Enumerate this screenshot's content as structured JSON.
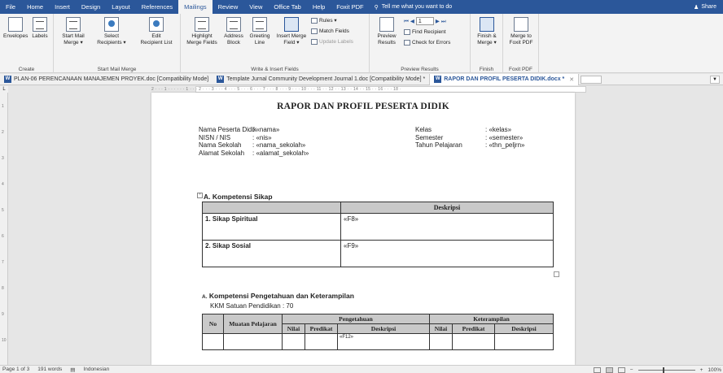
{
  "ribbon_tabs": [
    "File",
    "Home",
    "Insert",
    "Design",
    "Layout",
    "References",
    "Mailings",
    "Review",
    "View",
    "Office Tab",
    "Help",
    "Foxit PDF"
  ],
  "active_tab": "Mailings",
  "tell_me": "Tell me what you want to do",
  "share": "Share",
  "ribbon": {
    "create": {
      "label": "Create",
      "envelopes": "Envelopes",
      "labels": "Labels"
    },
    "start_mail_merge": {
      "label": "Start Mail Merge",
      "start": [
        "Start Mail",
        "Merge ▾"
      ],
      "select": [
        "Select",
        "Recipients ▾"
      ],
      "edit": [
        "Edit",
        "Recipient List"
      ]
    },
    "write_insert": {
      "label": "Write & Insert Fields",
      "highlight": [
        "Highlight",
        "Merge Fields"
      ],
      "address": [
        "Address",
        "Block"
      ],
      "greeting": [
        "Greeting",
        "Line"
      ],
      "insert_merge": [
        "Insert Merge",
        "Field ▾"
      ],
      "rules": "Rules ▾",
      "match": "Match Fields",
      "update": "Update Labels"
    },
    "preview": {
      "label": "Preview Results",
      "preview_results": [
        "Preview",
        "Results"
      ],
      "record": "1",
      "find": "Find Recipient",
      "check": "Check for Errors"
    },
    "finish": {
      "label": "Finish",
      "btn": [
        "Finish &",
        "Merge ▾"
      ]
    },
    "foxit": {
      "label": "Foxit PDF",
      "btn": [
        "Merge to",
        "Foxit PDF"
      ]
    }
  },
  "doc_tabs": [
    {
      "name": "PLAN-06 PERENCANAAN MANAJEMEN PROYEK.doc [Compatibility Mode]",
      "active": false
    },
    {
      "name": "Template Jurnal Community Development Journal 1.doc [Compatibility Mode] *",
      "active": false
    },
    {
      "name": "RAPOR DAN PROFIL PESERTA DIDIK.docx *",
      "active": true
    }
  ],
  "ruler_ticks": "2 · · · 1 · · · · · · 1 · · · 2 · · · 3 · · · 4 · · · 5 · · · 6 · · · 7 · · · 8 · · · 9 · · · 10 · · · 11 · · 12 · · 13 · · 14 · · 15 · · 16 · · · 18 ·",
  "document": {
    "title": "RAPOR DAN PROFIL PESERTA DIDIK",
    "info_left": [
      {
        "k": "Nama Peserta Didik",
        "v": ": «nama»"
      },
      {
        "k": "NISN / NIS",
        "v": ": «nis»"
      },
      {
        "k": "Nama Sekolah",
        "v": ": «nama_sekolah»"
      },
      {
        "k": "Alamat Sekolah",
        "v": ": «alamat_sekolah»"
      }
    ],
    "info_right": [
      {
        "k": "Kelas",
        "v": ": «kelas»"
      },
      {
        "k": "Semester",
        "v": ": «semester»"
      },
      {
        "k": "Tahun Pelajaran",
        "v": ": «thn_peljrn»"
      }
    ],
    "section_a": "A.  Kompetensi Sikap",
    "table1": {
      "header": "Deskripsi",
      "rows": [
        {
          "label": "1. Sikap Spiritual",
          "value": "«F8»"
        },
        {
          "label": "2. Sikap Sosial",
          "value": "«F9»"
        }
      ]
    },
    "section_b_prefix": "A.",
    "section_b": "Kompetensi Pengetahuan dan Keterampilan",
    "kkm": "KKM Satuan Pendidikan    : 70",
    "table2": {
      "no": "No",
      "muatan": "Muatan Pelajaran",
      "pengetahuan": "Pengetahuan",
      "keterampilan": "Keterampilan",
      "nilai": "Nilai",
      "predikat": "Predikat",
      "deskripsi": "Deskripsi",
      "first_cell": "«F12»"
    }
  },
  "status": {
    "page": "Page 1 of 3",
    "words": "191 words",
    "lang": "Indonesian",
    "zoom": "100%"
  }
}
